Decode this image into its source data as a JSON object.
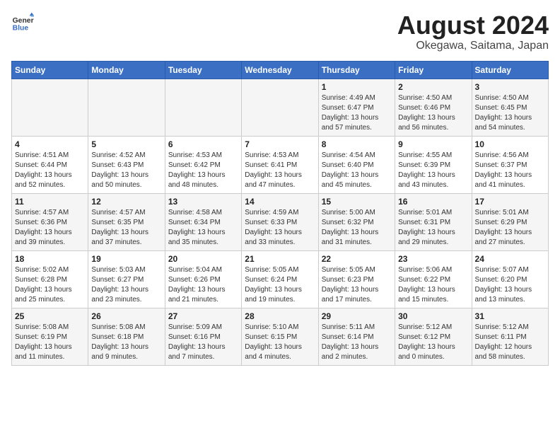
{
  "header": {
    "logo_line1": "General",
    "logo_line2": "Blue",
    "month_year": "August 2024",
    "location": "Okegawa, Saitama, Japan"
  },
  "days_of_week": [
    "Sunday",
    "Monday",
    "Tuesday",
    "Wednesday",
    "Thursday",
    "Friday",
    "Saturday"
  ],
  "weeks": [
    [
      {
        "day": "",
        "content": ""
      },
      {
        "day": "",
        "content": ""
      },
      {
        "day": "",
        "content": ""
      },
      {
        "day": "",
        "content": ""
      },
      {
        "day": "1",
        "content": "Sunrise: 4:49 AM\nSunset: 6:47 PM\nDaylight: 13 hours\nand 57 minutes."
      },
      {
        "day": "2",
        "content": "Sunrise: 4:50 AM\nSunset: 6:46 PM\nDaylight: 13 hours\nand 56 minutes."
      },
      {
        "day": "3",
        "content": "Sunrise: 4:50 AM\nSunset: 6:45 PM\nDaylight: 13 hours\nand 54 minutes."
      }
    ],
    [
      {
        "day": "4",
        "content": "Sunrise: 4:51 AM\nSunset: 6:44 PM\nDaylight: 13 hours\nand 52 minutes."
      },
      {
        "day": "5",
        "content": "Sunrise: 4:52 AM\nSunset: 6:43 PM\nDaylight: 13 hours\nand 50 minutes."
      },
      {
        "day": "6",
        "content": "Sunrise: 4:53 AM\nSunset: 6:42 PM\nDaylight: 13 hours\nand 48 minutes."
      },
      {
        "day": "7",
        "content": "Sunrise: 4:53 AM\nSunset: 6:41 PM\nDaylight: 13 hours\nand 47 minutes."
      },
      {
        "day": "8",
        "content": "Sunrise: 4:54 AM\nSunset: 6:40 PM\nDaylight: 13 hours\nand 45 minutes."
      },
      {
        "day": "9",
        "content": "Sunrise: 4:55 AM\nSunset: 6:39 PM\nDaylight: 13 hours\nand 43 minutes."
      },
      {
        "day": "10",
        "content": "Sunrise: 4:56 AM\nSunset: 6:37 PM\nDaylight: 13 hours\nand 41 minutes."
      }
    ],
    [
      {
        "day": "11",
        "content": "Sunrise: 4:57 AM\nSunset: 6:36 PM\nDaylight: 13 hours\nand 39 minutes."
      },
      {
        "day": "12",
        "content": "Sunrise: 4:57 AM\nSunset: 6:35 PM\nDaylight: 13 hours\nand 37 minutes."
      },
      {
        "day": "13",
        "content": "Sunrise: 4:58 AM\nSunset: 6:34 PM\nDaylight: 13 hours\nand 35 minutes."
      },
      {
        "day": "14",
        "content": "Sunrise: 4:59 AM\nSunset: 6:33 PM\nDaylight: 13 hours\nand 33 minutes."
      },
      {
        "day": "15",
        "content": "Sunrise: 5:00 AM\nSunset: 6:32 PM\nDaylight: 13 hours\nand 31 minutes."
      },
      {
        "day": "16",
        "content": "Sunrise: 5:01 AM\nSunset: 6:31 PM\nDaylight: 13 hours\nand 29 minutes."
      },
      {
        "day": "17",
        "content": "Sunrise: 5:01 AM\nSunset: 6:29 PM\nDaylight: 13 hours\nand 27 minutes."
      }
    ],
    [
      {
        "day": "18",
        "content": "Sunrise: 5:02 AM\nSunset: 6:28 PM\nDaylight: 13 hours\nand 25 minutes."
      },
      {
        "day": "19",
        "content": "Sunrise: 5:03 AM\nSunset: 6:27 PM\nDaylight: 13 hours\nand 23 minutes."
      },
      {
        "day": "20",
        "content": "Sunrise: 5:04 AM\nSunset: 6:26 PM\nDaylight: 13 hours\nand 21 minutes."
      },
      {
        "day": "21",
        "content": "Sunrise: 5:05 AM\nSunset: 6:24 PM\nDaylight: 13 hours\nand 19 minutes."
      },
      {
        "day": "22",
        "content": "Sunrise: 5:05 AM\nSunset: 6:23 PM\nDaylight: 13 hours\nand 17 minutes."
      },
      {
        "day": "23",
        "content": "Sunrise: 5:06 AM\nSunset: 6:22 PM\nDaylight: 13 hours\nand 15 minutes."
      },
      {
        "day": "24",
        "content": "Sunrise: 5:07 AM\nSunset: 6:20 PM\nDaylight: 13 hours\nand 13 minutes."
      }
    ],
    [
      {
        "day": "25",
        "content": "Sunrise: 5:08 AM\nSunset: 6:19 PM\nDaylight: 13 hours\nand 11 minutes."
      },
      {
        "day": "26",
        "content": "Sunrise: 5:08 AM\nSunset: 6:18 PM\nDaylight: 13 hours\nand 9 minutes."
      },
      {
        "day": "27",
        "content": "Sunrise: 5:09 AM\nSunset: 6:16 PM\nDaylight: 13 hours\nand 7 minutes."
      },
      {
        "day": "28",
        "content": "Sunrise: 5:10 AM\nSunset: 6:15 PM\nDaylight: 13 hours\nand 4 minutes."
      },
      {
        "day": "29",
        "content": "Sunrise: 5:11 AM\nSunset: 6:14 PM\nDaylight: 13 hours\nand 2 minutes."
      },
      {
        "day": "30",
        "content": "Sunrise: 5:12 AM\nSunset: 6:12 PM\nDaylight: 13 hours\nand 0 minutes."
      },
      {
        "day": "31",
        "content": "Sunrise: 5:12 AM\nSunset: 6:11 PM\nDaylight: 12 hours\nand 58 minutes."
      }
    ]
  ]
}
